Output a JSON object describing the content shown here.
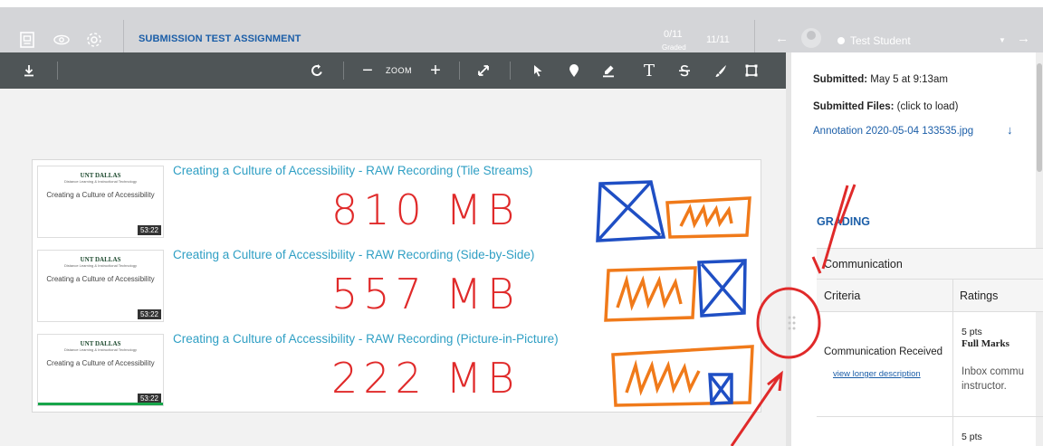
{
  "header": {
    "assignment_title": "SUBMISSION TEST ASSIGNMENT",
    "graded_count": "0/11",
    "graded_label": "Graded",
    "progress": "11/11",
    "student_name": "Test Student"
  },
  "toolbar": {
    "zoom_label": "ZOOM",
    "zoom_out": "−",
    "zoom_in": "+",
    "text_tool": "T"
  },
  "document": {
    "recordings": [
      {
        "title": "Creating a Culture of Accessibility - RAW Recording (Tile Streams)",
        "size": "810 MB",
        "thumb_brand": "UNT DALLAS",
        "thumb_sub": "Distance Learning & Instructional Technology",
        "thumb_title": "Creating a Culture of Accessibility",
        "duration": "53:22"
      },
      {
        "title": "Creating a Culture of Accessibility - RAW Recording (Side-by-Side)",
        "size": "557 MB",
        "thumb_brand": "UNT DALLAS",
        "thumb_sub": "Distance Learning & Instructional Technology",
        "thumb_title": "Creating a Culture of Accessibility",
        "duration": "53:22"
      },
      {
        "title": "Creating a Culture of Accessibility - RAW Recording (Picture-in-Picture)",
        "size": "222 MB",
        "thumb_brand": "UNT DALLAS",
        "thumb_sub": "Distance Learning & Instructional Technology",
        "thumb_title": "Creating a Culture of Accessibility",
        "duration": "53:22"
      }
    ]
  },
  "panel": {
    "submitted_label": "Submitted:",
    "submitted_value": "May 5 at 9:13am",
    "files_label": "Submitted Files:",
    "files_hint": "(click to load)",
    "file_name": "Annotation 2020-05-04 133535.jpg",
    "grading_heading": "GRADING",
    "rubric": {
      "title": "Communication",
      "col_criteria": "Criteria",
      "col_ratings": "Ratings",
      "criterion": "Communication Received",
      "criterion_link": "view longer description",
      "rating_pts": "5 pts",
      "rating_name": "Full Marks",
      "rating_desc_1": "Inbox commu",
      "rating_desc_2": "instructor.",
      "next_pts": "5 pts"
    }
  },
  "colors": {
    "header_bg": "#d4d5d8",
    "toolbar_bg": "#4f5557",
    "link": "#1b5ea8",
    "title_cyan": "#2f9fc4",
    "annotation_red": "#e02a2a",
    "annotation_blue": "#1f4fc4",
    "annotation_orange": "#f07a1a"
  }
}
